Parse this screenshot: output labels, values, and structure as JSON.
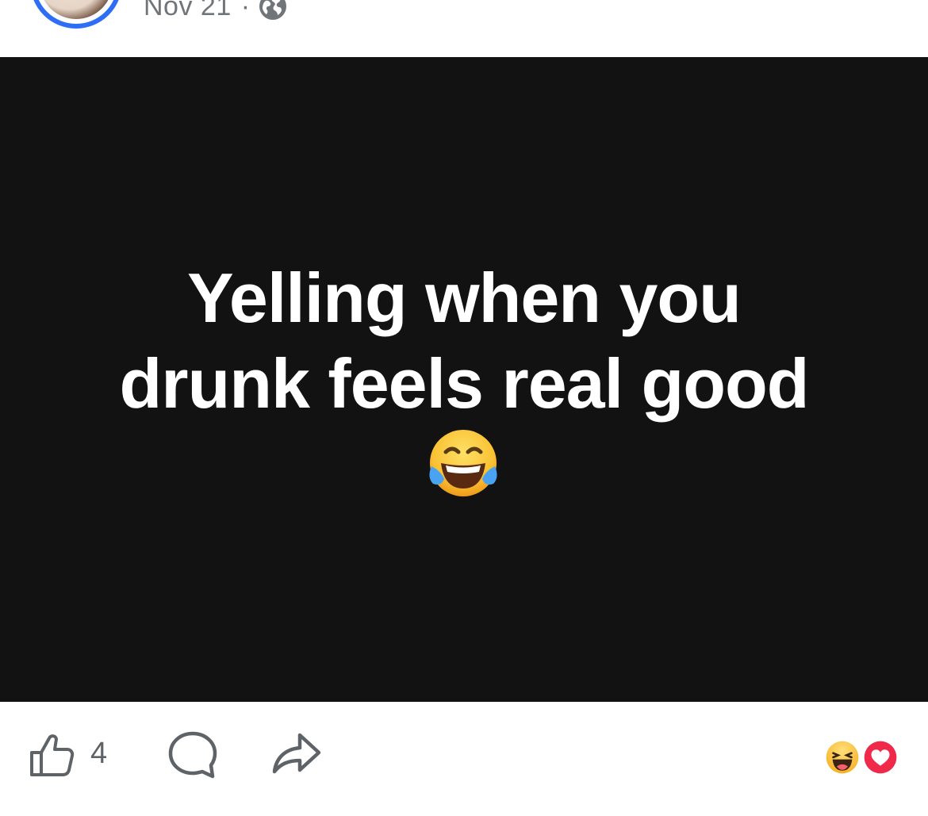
{
  "header": {
    "date": "Nov 21",
    "separator": "·",
    "privacy_icon": "globe-icon",
    "avatar_ring_color": "#2d6ef5"
  },
  "post": {
    "text_lines": [
      "Yelling when you",
      "drunk feels real good"
    ],
    "emoji": "face-with-tears-of-joy",
    "background_color": "#121212",
    "text_color": "#ffffff"
  },
  "actions": {
    "like_icon": "thumbs-up-icon",
    "like_count": "4",
    "comment_icon": "comment-icon",
    "share_icon": "share-icon",
    "reactions": [
      "haha-reaction-icon",
      "love-reaction-icon"
    ],
    "love_color": "#f0284a"
  }
}
